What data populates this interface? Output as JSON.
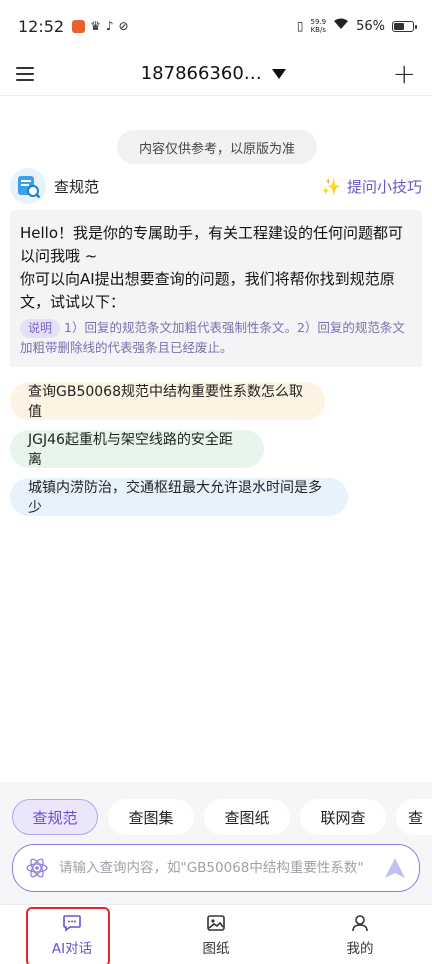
{
  "status_bar": {
    "time": "12:52",
    "net_speed_value": "59.9",
    "net_speed_unit": "KB/s",
    "battery": "56%",
    "battery_level": 0.56
  },
  "header": {
    "title": "187866360…",
    "menu_icon": "menu-icon",
    "add_icon": "plus-icon"
  },
  "notice": "内容仅供参考，以原版为准",
  "bot": {
    "name": "查规范",
    "tips_label": "提问小技巧"
  },
  "message": {
    "greeting": "Hello！我是你的专属助手，有关工程建设的任何问题都可以问我哦 ~\n你可以向AI提出想要查询的问题，我们将帮你找到规范原文，试试以下：",
    "note_tag": "说明",
    "note_text": "1）回复的规范条文加粗代表强制性条文。2）回复的规范条文加粗带删除线的代表强条且已经废止。"
  },
  "suggestions": [
    "查询GB50068规范中结构重要性系数怎么取值",
    "JGJ46起重机与架空线路的安全距离",
    "城镇内涝防治，交通枢纽最大允许退水时间是多少"
  ],
  "mode_tabs": [
    "查规范",
    "查图集",
    "查图纸",
    "联网查",
    "查"
  ],
  "input": {
    "placeholder": "请输入查询内容，如\"GB50068中结构重要性系数\""
  },
  "bottom_nav": [
    {
      "label": "AI对话",
      "icon": "chat-icon"
    },
    {
      "label": "图纸",
      "icon": "image-icon"
    },
    {
      "label": "我的",
      "icon": "user-icon"
    }
  ],
  "colors": {
    "accent": "#6a4fd3",
    "highlight_box": "#e5262b"
  }
}
